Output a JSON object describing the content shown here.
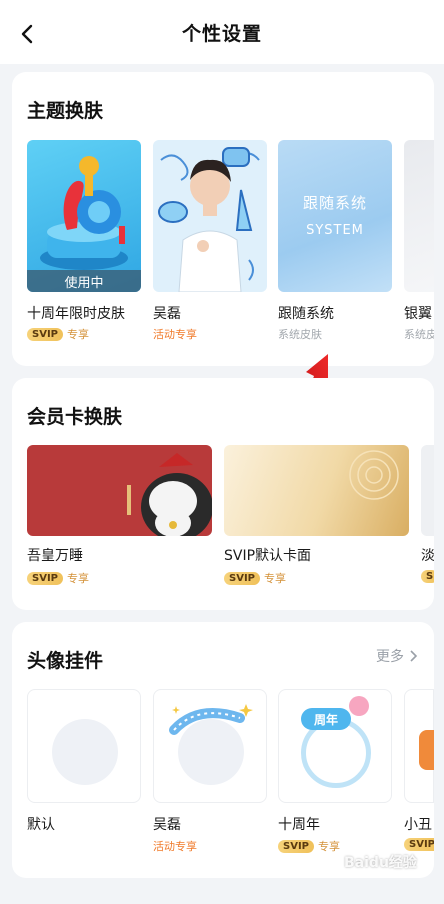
{
  "header": {
    "title": "个性设置"
  },
  "themes": {
    "title": "主题换肤",
    "items": [
      {
        "name": "十周年限时皮肤",
        "status": "使用中",
        "tag_badge": "SVIP",
        "tag_text": "专享"
      },
      {
        "name": "吴磊",
        "tag_text": "活动专享"
      },
      {
        "name": "跟随系统",
        "preview_line1": "跟随系统",
        "preview_line2": "SYSTEM",
        "tag_text": "系统皮肤"
      },
      {
        "name": "银翼",
        "tag_text": "系统皮"
      }
    ]
  },
  "member_cards": {
    "title": "会员卡换肤",
    "items": [
      {
        "name": "吾皇万睡",
        "tag_badge": "SVIP",
        "tag_text": "专享"
      },
      {
        "name": "SVIP默认卡面",
        "tag_badge": "SVIP",
        "tag_text": "专享"
      },
      {
        "name": "淡",
        "tag_badge": "S"
      }
    ]
  },
  "pendants": {
    "title": "头像挂件",
    "more_label": "更多",
    "items": [
      {
        "name": "默认"
      },
      {
        "name": "吴磊",
        "tag_text": "活动专享"
      },
      {
        "name": "十周年",
        "decor_text": "周年",
        "tag_badge": "SVIP",
        "tag_text": "专享"
      },
      {
        "name": "小丑",
        "tag_badge": "SVIP"
      }
    ]
  },
  "watermark": {
    "text": "Baidu经验"
  }
}
